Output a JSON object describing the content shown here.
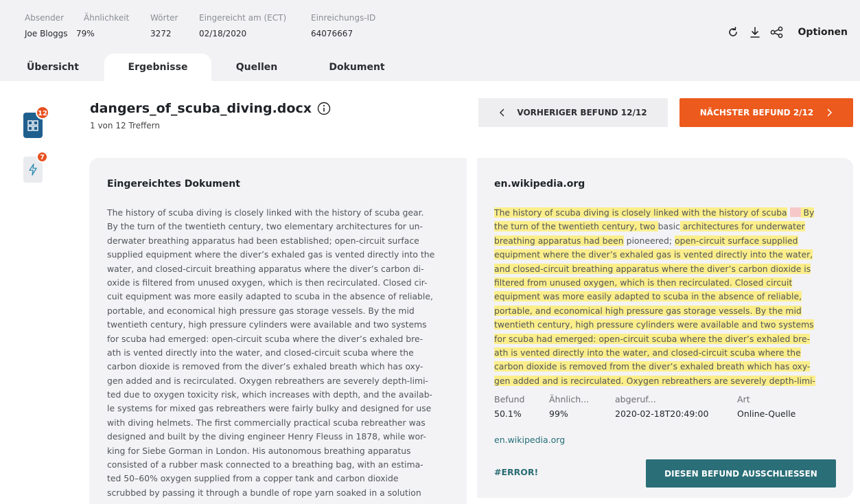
{
  "meta": [
    {
      "label": "Absender",
      "value": "Joe Bloggs"
    },
    {
      "label": "Ähnlichkeit",
      "value": "79%"
    },
    {
      "label": "Wörter",
      "value": "3272"
    },
    {
      "label": "Eingereicht am (ECT)",
      "value": "02/18/2020"
    },
    {
      "label": "Einreichungs-ID",
      "value": "64076667"
    }
  ],
  "header": {
    "options_label": "Optionen"
  },
  "tabs": [
    "Übersicht",
    "Ergebnisse",
    "Quellen",
    "Dokument"
  ],
  "rail": {
    "matches_count": "12",
    "flags_count": "7"
  },
  "document": {
    "filename": "dangers_of_scuba_diving.docx",
    "hits": "1 von 12 Treffern"
  },
  "nav": {
    "prev_label": "VORHERIGER BEFUND 12/12",
    "next_label": "NÄCHSTER BEFUND 2/12"
  },
  "submitted": {
    "heading": "Eingereichtes Dokument",
    "lines": [
      "The history of scuba diving is closely linked with the history of scuba gear.",
      "By the turn of the twentieth century, two elementary architectures for un-",
      "derwater breathing apparatus had been established; open-circuit surface",
      "supplied equipment where the diver’s exhaled gas is vented directly into the",
      "water, and closed-circuit breathing apparatus where the diver’s carbon di-",
      "oxide is filtered from unused oxygen, which is then recirculated. Closed cir-",
      "cuit equipment was more easily adapted to scuba in the absence of reliable,",
      "portable, and economical high pressure gas storage vessels. By the mid",
      "twentieth century, high pressure cylinders were available and two systems",
      "for scuba had emerged: open-circuit scuba where the diver’s exhaled bre-",
      "ath is vented directly into the water, and closed-circuit scuba where the",
      "carbon dioxide is removed from the diver’s exhaled breath which has oxy-",
      "gen added and is recirculated. Oxygen rebreathers are severely depth-limi-",
      "ted due to oxygen toxicity risk, which increases with depth, and the availab-",
      "le systems for mixed gas rebreathers were fairly bulky and designed for use",
      "with diving helmets. The first commercially practical scuba rebreather was",
      "designed and built by the diving engineer Henry Fleuss in 1878, while wor-",
      "king for Siebe Gorman in London. His autonomous breathing apparatus",
      "consisted of a rubber mask connected to a breathing bag, with an estima-",
      "ted 50–60% oxygen supplied from a copper tank and carbon dioxide",
      "scrubbed by passing it through a bundle of rope yarn soaked in a solution"
    ]
  },
  "source": {
    "heading": "en.wikipedia.org",
    "lines": [
      [
        {
          "t": "The history of scuba diving is closely linked with the history of scuba",
          "h": true
        },
        {
          "t": " ",
          "h": false
        },
        {
          "t": "",
          "h": "pink"
        },
        {
          "t": " By",
          "h": true
        }
      ],
      [
        {
          "t": "the turn of the twentieth century, two ",
          "h": true
        },
        {
          "t": "basic",
          "h": false
        },
        {
          "t": " architectures for underwater",
          "h": true
        }
      ],
      [
        {
          "t": "breathing apparatus had been",
          "h": true
        },
        {
          "t": " pioneered; ",
          "h": false
        },
        {
          "t": "open-circuit surface supplied",
          "h": true
        }
      ],
      [
        {
          "t": "equipment where the diver’s exhaled gas is vented directly into the water,",
          "h": true
        }
      ],
      [
        {
          "t": "and closed-circuit breathing apparatus where the diver’s carbon dioxide is",
          "h": true
        }
      ],
      [
        {
          "t": "filtered from unused oxygen, which is then recirculated. Closed circuit",
          "h": true
        }
      ],
      [
        {
          "t": "equipment was more easily adapted to scuba in the absence of reliable,",
          "h": true
        }
      ],
      [
        {
          "t": "portable, and economical high pressure gas storage vessels. By the mid",
          "h": true
        }
      ],
      [
        {
          "t": "twentieth century, high pressure cylinders were available and two systems",
          "h": true
        }
      ],
      [
        {
          "t": "for scuba had emerged: open-circuit scuba where the diver’s exhaled bre-",
          "h": true
        }
      ],
      [
        {
          "t": "ath is vented directly into the water, and closed-circuit scuba where the",
          "h": true
        }
      ],
      [
        {
          "t": "carbon dioxide is removed from the diver’s exhaled breath which has oxy-",
          "h": true
        }
      ],
      [
        {
          "t": "gen added and is recirculated. Oxygen rebreathers are severely depth-limi-",
          "h": true
        }
      ]
    ],
    "info": [
      {
        "label": "Befund",
        "value": "50.1%"
      },
      {
        "label": "Ähnlich...",
        "value": "99%"
      },
      {
        "label": "abgeruf...",
        "value": "2020-02-18T20:49:00"
      },
      {
        "label": "Art",
        "value": "Online-Quelle"
      }
    ],
    "link": "en.wikipedia.org",
    "error": "#ERROR!",
    "exclude_label": "DIESEN BEFUND AUSSCHLIESSEN"
  },
  "colors": {
    "accent_orange": "#ec5a1d",
    "accent_teal": "#2a6e78",
    "rail_blue": "#1f5f8e",
    "highlight": "#fbee8a"
  }
}
